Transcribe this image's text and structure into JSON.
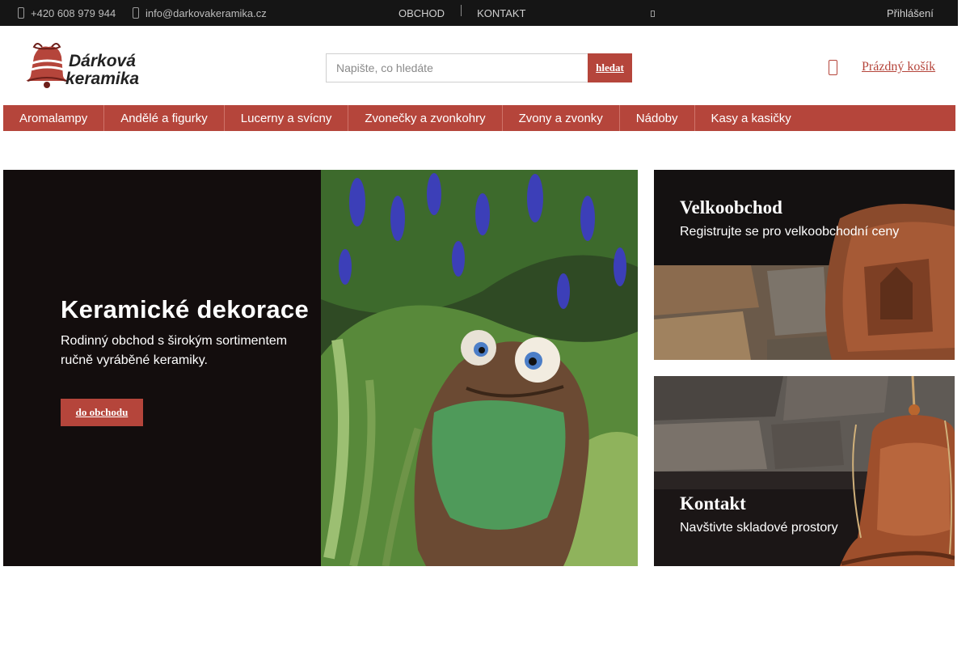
{
  "topbar": {
    "phone": "+420 608 979 944",
    "email": "info@darkovakeramika.cz",
    "nav": [
      "OBCHOD",
      "KONTAKT"
    ],
    "login": "Přihlášení"
  },
  "logo": {
    "line1": "Dárková",
    "line2": "keramika"
  },
  "search": {
    "placeholder": "Napište, co hledáte",
    "button": "hledat"
  },
  "cart": {
    "label": "Prázdný košík"
  },
  "categories": [
    "Aromalampy",
    "Andělé a figurky",
    "Lucerny a svícny",
    "Zvonečky a zvonkohry",
    "Zvony a zvonky",
    "Nádoby",
    "Kasy a kasičky"
  ],
  "hero": {
    "title": "Keramické dekorace",
    "text": "Rodinný obchod s širokým sortimentem ručně vyráběné keramiky.",
    "button": "do obchodu"
  },
  "panels": [
    {
      "title": "Velkoobchod",
      "subtitle": "Registrujte se pro velkoobchodní ceny"
    },
    {
      "title": "Kontakt",
      "subtitle": "Navštivte skladové prostory"
    }
  ],
  "colors": {
    "accent": "#b5453b",
    "topbar": "#151515",
    "hero_bg": "#130d0d"
  },
  "icons": {
    "phone": "phone-icon",
    "email": "envelope-icon",
    "cart": "shopping-bag-icon"
  }
}
